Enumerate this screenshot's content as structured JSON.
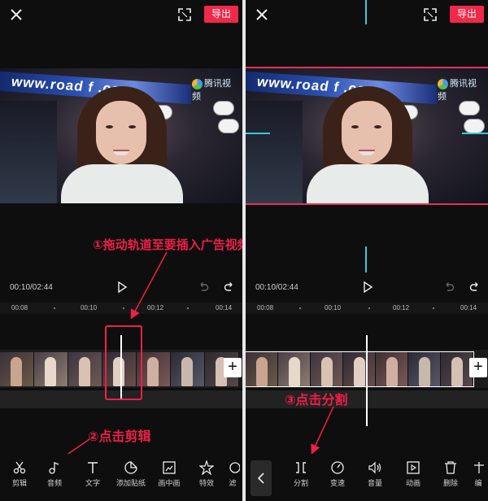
{
  "topbar": {
    "export_label": "导出"
  },
  "video": {
    "banner_text": "www.road f   .com",
    "logo_text": "腾讯视频"
  },
  "left": {
    "annotation_drag": "①拖动轨道至要插入广告视频的位置",
    "annotation_edit": "②点击剪辑",
    "time": "00:10/02:44",
    "ruler": [
      "00:08",
      "00:10",
      "00:12",
      "00:14"
    ],
    "tools": [
      {
        "icon": "scissors-icon",
        "label": "剪辑"
      },
      {
        "icon": "music-note-icon",
        "label": "音频"
      },
      {
        "icon": "text-icon",
        "label": "文字"
      },
      {
        "icon": "sticker-icon",
        "label": "添加贴纸"
      },
      {
        "icon": "picture-in-picture-icon",
        "label": "画中画"
      },
      {
        "icon": "effects-icon",
        "label": "特效"
      },
      {
        "icon": "filter-icon",
        "label": "滤"
      }
    ]
  },
  "right": {
    "annotation_split": "③点击分割",
    "time": "00:10/02:44",
    "ruler": [
      "00:08",
      "00:10",
      "00:12",
      "00:14"
    ],
    "tools": [
      {
        "icon": "split-icon",
        "label": "分割"
      },
      {
        "icon": "speed-icon",
        "label": "变速"
      },
      {
        "icon": "volume-icon",
        "label": "音量"
      },
      {
        "icon": "animation-icon",
        "label": "动画"
      },
      {
        "icon": "delete-icon",
        "label": "删除"
      },
      {
        "icon": "edit-icon",
        "label": "编"
      }
    ]
  },
  "colors": {
    "accent": "#ee1f48",
    "export_bg": "#f0284a",
    "cyan": "#3bc7d8"
  }
}
